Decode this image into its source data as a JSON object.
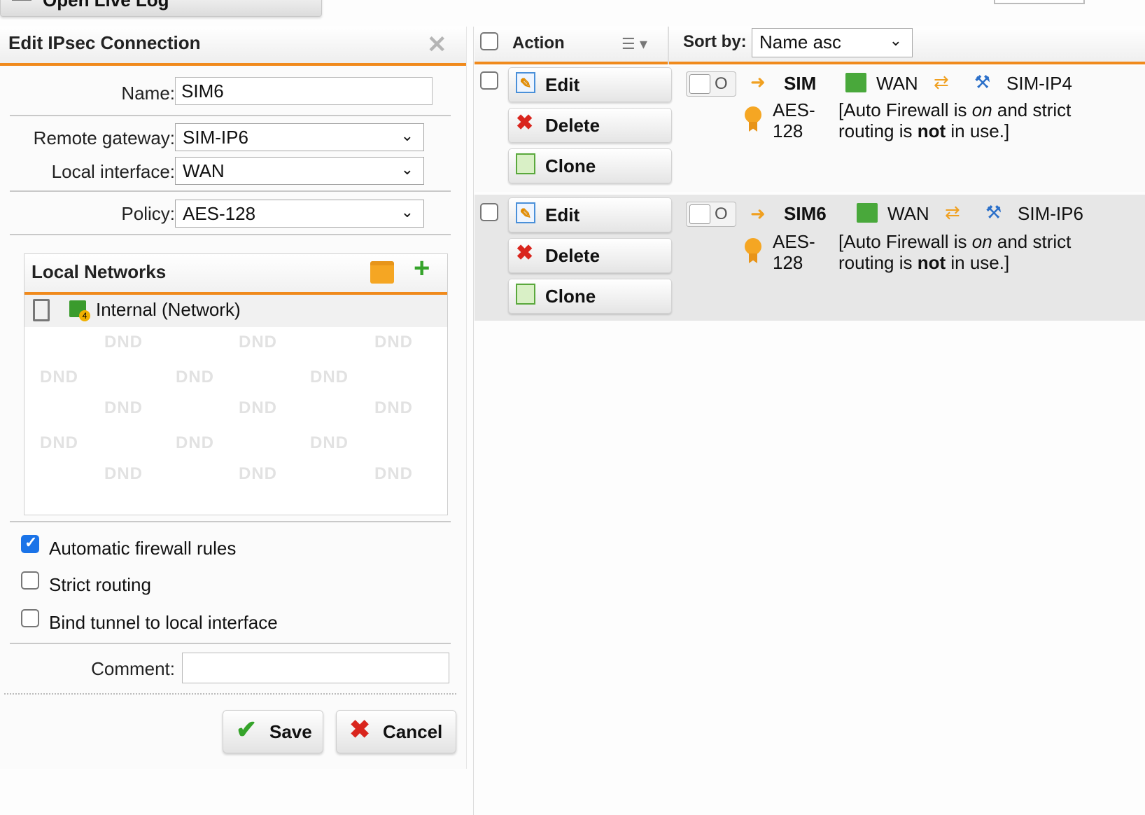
{
  "top": {
    "button_label": "Open Live Log"
  },
  "dialog": {
    "title": "Edit IPsec Connection",
    "name_label": "Name:",
    "name_value": "SIM6",
    "remote_gateway_label": "Remote gateway:",
    "remote_gateway_value": "SIM-IP6",
    "local_interface_label": "Local interface:",
    "local_interface_value": "WAN",
    "policy_label": "Policy:",
    "policy_value": "AES-128",
    "local_networks": {
      "title": "Local Networks",
      "items": [
        {
          "label": "Internal (Network)",
          "badge": "4"
        }
      ],
      "dnd_text": "DND"
    },
    "checkboxes": [
      {
        "label": "Automatic firewall rules",
        "checked": true
      },
      {
        "label": "Strict routing",
        "checked": false
      },
      {
        "label": "Bind tunnel to local interface",
        "checked": false
      }
    ],
    "comment_label": "Comment:",
    "comment_value": "",
    "save_label": "Save",
    "cancel_label": "Cancel"
  },
  "list": {
    "action_label": "Action",
    "sort_label": "Sort by:",
    "sort_value": "Name asc",
    "rows": [
      {
        "name": "SIM",
        "interface": "WAN",
        "gateway": "SIM-IP4",
        "policy_line1": "AES-",
        "policy_line2": "128",
        "desc_line1_a": "[Auto Firewall is ",
        "desc_line1_b": "on",
        "desc_line1_c": " and strict",
        "desc_line2_a": "routing is ",
        "desc_line2_b": "not",
        "desc_line2_c": " in use.]",
        "edit": "Edit",
        "delete": "Delete",
        "clone": "Clone"
      },
      {
        "name": "SIM6",
        "interface": "WAN",
        "gateway": "SIM-IP6",
        "policy_line1": "AES-",
        "policy_line2": "128",
        "desc_line1_a": "[Auto Firewall is ",
        "desc_line1_b": "on",
        "desc_line1_c": " and strict",
        "desc_line2_a": "routing is ",
        "desc_line2_b": "not",
        "desc_line2_c": " in use.]",
        "edit": "Edit",
        "delete": "Delete",
        "clone": "Clone"
      }
    ]
  },
  "colors": {
    "accent": "#f08a1c",
    "save_check": "#35a32a",
    "cancel_x": "#d9251d",
    "checkbox_on": "#1a73e8",
    "row_selected_bg": "#e7e7e7"
  }
}
